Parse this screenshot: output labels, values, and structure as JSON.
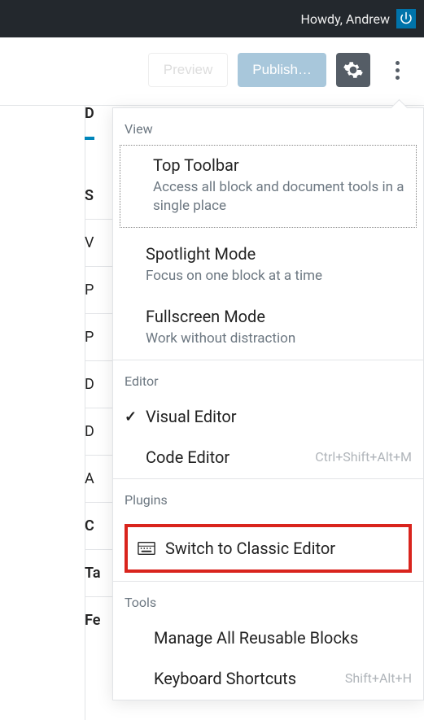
{
  "admin_bar": {
    "greeting": "Howdy, Andrew"
  },
  "toolbar": {
    "preview_label": "Preview",
    "publish_label": "Publish…"
  },
  "background_tabs": {
    "d": "D",
    "rows": [
      "S",
      "V",
      "P",
      "P",
      "D",
      "D",
      "A",
      "C",
      "Ta",
      "Fe"
    ]
  },
  "menu": {
    "sections": {
      "view": {
        "label": "View",
        "items": [
          {
            "title": "Top Toolbar",
            "desc": "Access all block and document tools in a single place"
          },
          {
            "title": "Spotlight Mode",
            "desc": "Focus on one block at a time"
          },
          {
            "title": "Fullscreen Mode",
            "desc": "Work without distraction"
          }
        ]
      },
      "editor": {
        "label": "Editor",
        "items": [
          {
            "title": "Visual Editor",
            "checked": true
          },
          {
            "title": "Code Editor",
            "kbd": "Ctrl+Shift+Alt+M"
          }
        ]
      },
      "plugins": {
        "label": "Plugins",
        "items": [
          {
            "title": "Switch to Classic Editor"
          }
        ]
      },
      "tools": {
        "label": "Tools",
        "items": [
          {
            "title": "Manage All Reusable Blocks"
          },
          {
            "title": "Keyboard Shortcuts",
            "kbd": "Shift+Alt+H"
          }
        ]
      }
    }
  }
}
